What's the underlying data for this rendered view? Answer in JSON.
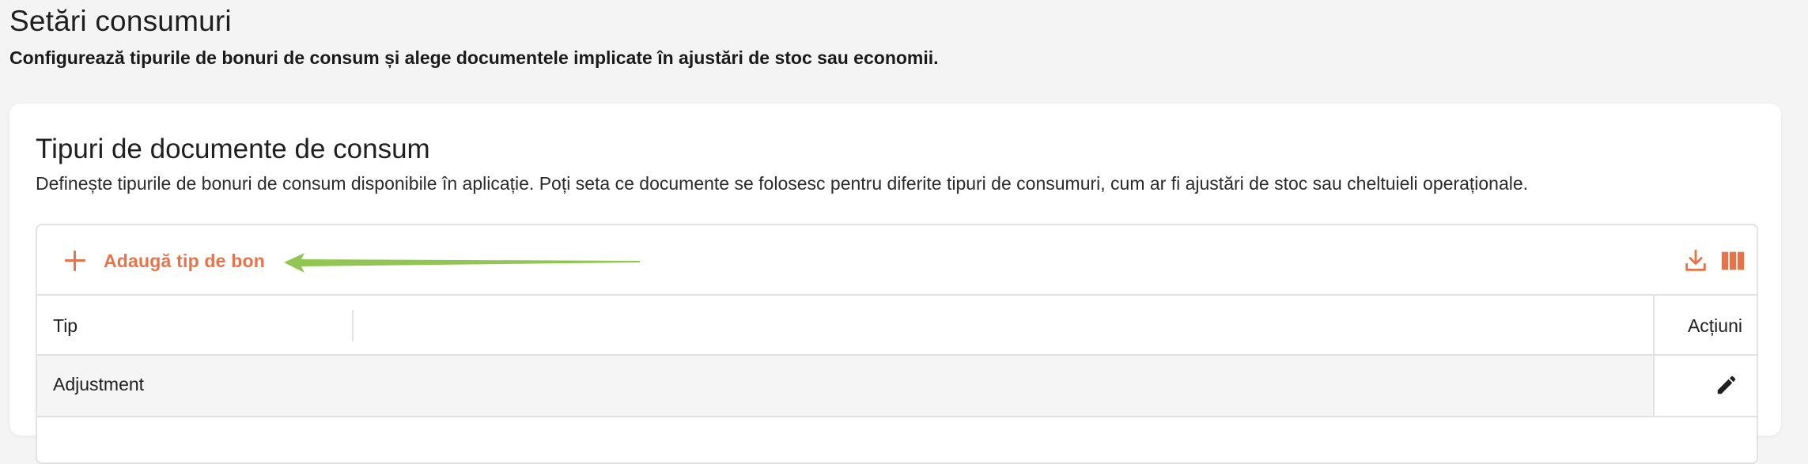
{
  "page": {
    "title": "Setări consumuri",
    "subtitle": "Configurează tipurile de bonuri de consum și alege documentele implicate în ajustări de stoc sau economii."
  },
  "card": {
    "title": "Tipuri de documente de consum",
    "description": "Definește tipurile de bonuri de consum disponibile în aplicație. Poți seta ce documente se folosesc pentru diferite tipuri de consumuri, cum ar fi ajustări de stoc sau cheltuieli operaționale."
  },
  "toolbar": {
    "add_label": "Adaugă tip de bon",
    "add_icon": "plus-icon",
    "export_icon": "download-icon",
    "columns_icon": "columns-icon"
  },
  "table": {
    "columns": [
      "Tip",
      "Acțiuni"
    ],
    "rows": [
      {
        "tip": "Adjustment",
        "action_icon": "pencil-icon"
      }
    ]
  },
  "colors": {
    "accent": "#e8734a",
    "annotation_arrow": "#8bc34a",
    "page_bg": "#f4f4f4",
    "card_bg": "#ffffff",
    "border": "#e2e2e2",
    "row_bg": "#f5f5f5"
  }
}
